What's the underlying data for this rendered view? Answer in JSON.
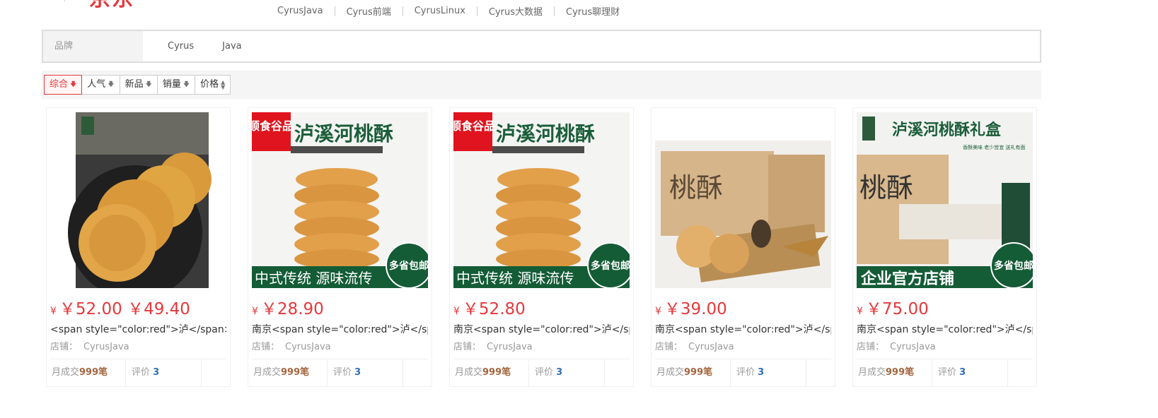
{
  "logo": {
    "symbol": "✳",
    "text": "京东"
  },
  "topnav": [
    "CyrusJava",
    "Cyrus前端",
    "CyrusLinux",
    "Cyrus大数据",
    "Cyrus聊理财"
  ],
  "brand": {
    "label": "品牌",
    "options": [
      "Cyrus",
      "Java"
    ]
  },
  "sort": {
    "items": [
      {
        "label": "综合",
        "arrow": "🡇",
        "active": true
      },
      {
        "label": "人气",
        "arrow": "🡇"
      },
      {
        "label": "新品",
        "arrow": "🡇"
      },
      {
        "label": "销量",
        "arrow": "🡇"
      },
      {
        "label": "价格",
        "arrow": "⬍"
      }
    ]
  },
  "products": [
    {
      "currency": "¥",
      "price": "￥52.00 ￥49.40",
      "title": "<span style=\"color:red\">泸</span>",
      "shop_label": "店铺：",
      "shop": "CyrusJava",
      "monthly_label": "月成交",
      "monthly": "999笔",
      "review_label": "评价",
      "reviews": "3",
      "image": "cookie-stack-dark-plate"
    },
    {
      "currency": "¥",
      "price": "￥28.90",
      "title": "南京<span style=\"color:red\">泸</sp",
      "shop_label": "店铺：",
      "shop": "CyrusJava",
      "monthly_label": "月成交",
      "monthly": "999笔",
      "review_label": "评价",
      "reviews": "3",
      "image": "luxihe-peach-cake-poster",
      "poster": {
        "badge": "顺食谷品",
        "headline": "泸溪河桃酥",
        "footer": "中式传统 源味流传",
        "corner": "多省包邮"
      }
    },
    {
      "currency": "¥",
      "price": "￥52.80",
      "title": "南京<span style=\"color:red\">泸</sp",
      "shop_label": "店铺：",
      "shop": "CyrusJava",
      "monthly_label": "月成交",
      "monthly": "999笔",
      "review_label": "评价",
      "reviews": "3",
      "image": "luxihe-peach-cake-poster",
      "poster": {
        "badge": "顺食谷品",
        "headline": "泸溪河桃酥",
        "footer": "中式传统 源味流传",
        "corner": "多省包邮"
      }
    },
    {
      "currency": "¥",
      "price": "￥39.00",
      "title": "南京<span style=\"color:red\">泸</sp",
      "shop_label": "店铺：",
      "shop": "CyrusJava",
      "monthly_label": "月成交",
      "monthly": "999笔",
      "review_label": "评价",
      "reviews": "3",
      "image": "peach-cake-gift-box-photo",
      "box_text": "桃酥"
    },
    {
      "currency": "¥",
      "price": "￥75.00",
      "title": "南京<span style=\"color:red\">泸</sp",
      "shop_label": "店铺：",
      "shop": "CyrusJava",
      "monthly_label": "月成交",
      "monthly": "999笔",
      "review_label": "评价",
      "reviews": "3",
      "image": "luxihe-gift-box-poster",
      "poster": {
        "headline": "泸溪河桃酥礼盒",
        "sub": "香酥美味 老少皆宜 送礼有面",
        "footer": "企业官方店铺",
        "corner": "多省包邮",
        "box_text": "桃酥"
      }
    }
  ]
}
